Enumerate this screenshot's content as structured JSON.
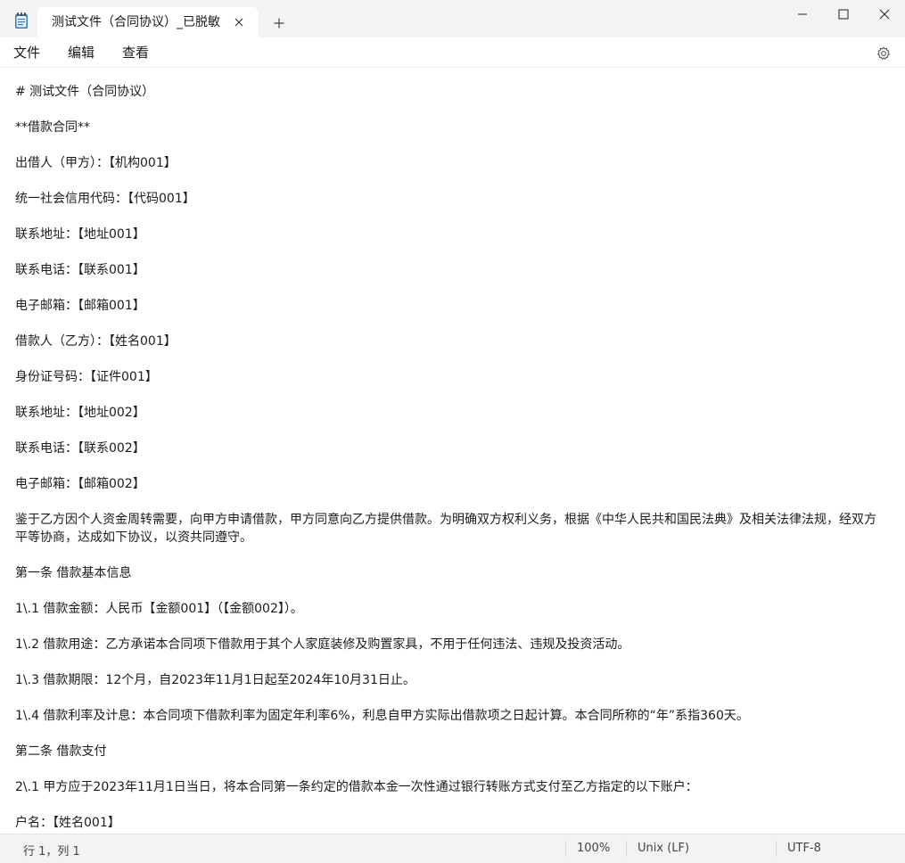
{
  "window": {
    "tab_title": "测试文件（合同协议）_已脱敏"
  },
  "menu": {
    "file": "文件",
    "edit": "编辑",
    "view": "查看"
  },
  "content": {
    "lines": [
      "# 测试文件（合同协议）",
      "**借款合同**",
      "出借人（甲方）：【机构001】",
      "统一社会信用代码：【代码001】",
      "联系地址：【地址001】",
      "联系电话：【联系001】",
      "电子邮箱：【邮箱001】",
      "借款人（乙方）：【姓名001】",
      "身份证号码：【证件001】",
      "联系地址：【地址002】",
      "联系电话：【联系002】",
      "电子邮箱：【邮箱002】",
      "鉴于乙方因个人资金周转需要，向甲方申请借款，甲方同意向乙方提供借款。为明确双方权利义务，根据《中华人民共和国民法典》及相关法律法规，经双方平等协商，达成如下协议，以资共同遵守。",
      "第一条 借款基本信息",
      "1\\.1 借款金额：人民币【金额001】（【金额002】）。",
      "1\\.2 借款用途：乙方承诺本合同项下借款用于其个人家庭装修及购置家具，不用于任何违法、违规及投资活动。",
      "1\\.3 借款期限：12个月，自2023年11月1日起至2024年10月31日止。",
      "1\\.4 借款利率及计息：本合同项下借款利率为固定年利率6%，利息自甲方实际出借款项之日起计算。本合同所称的“年”系指360天。",
      "第二条 借款支付",
      "2\\.1 甲方应于2023年11月1日当日，将本合同第一条约定的借款本金一次性通过银行转账方式支付至乙方指定的以下账户：",
      "户名：【姓名001】"
    ]
  },
  "status": {
    "position": "行 1，列 1",
    "zoom": "100%",
    "line_ending": "Unix (LF)",
    "encoding": "UTF-8"
  },
  "icons": {
    "app": "notepad-icon",
    "close_tab": "close-icon",
    "new_tab": "plus-icon",
    "minimize": "minimize-icon",
    "maximize": "maximize-icon",
    "close_window": "close-icon",
    "settings": "gear-icon"
  }
}
